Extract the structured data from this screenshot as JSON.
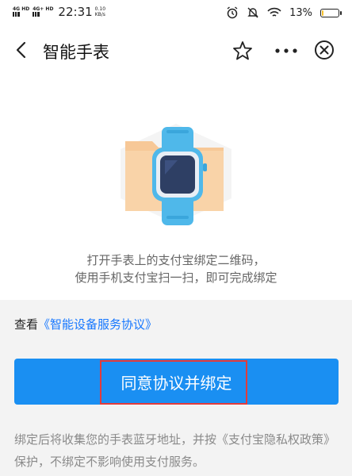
{
  "status_bar": {
    "net1": "4G HD",
    "net2": "4G+ HD",
    "time": "22:31",
    "speed_value": "0.10",
    "speed_unit": "KB/s",
    "battery_percent": "13%",
    "battery_level": 0.13,
    "icons": [
      "alarm-icon",
      "mute-icon",
      "wifi-icon",
      "battery-icon"
    ]
  },
  "nav": {
    "title": "智能手表",
    "icons": [
      "back-icon",
      "star-icon",
      "more-icon",
      "close-icon"
    ]
  },
  "main": {
    "description_line1": "打开手表上的支付宝绑定二维码，",
    "description_line2": "使用手机支付宝扫一扫，即可完成绑定",
    "agreement_prefix": "查看",
    "agreement_link": "《智能设备服务协议》",
    "primary_button": "同意协议并绑定",
    "footnote": "绑定后将收集您的手表蓝牙地址，并按《支付宝隐私权政策》保护，不绑定不影响使用支付服务。"
  },
  "colors": {
    "accent": "#1a8ff2",
    "link": "#1677ff",
    "highlight": "#e23b3b",
    "watch_band": "#4fb8ea",
    "folder": "#f7c897"
  }
}
